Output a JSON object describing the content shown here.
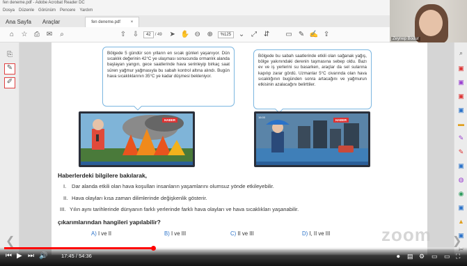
{
  "window": {
    "title": "fen deneme.pdf - Adobe Acrobat Reader DC"
  },
  "menu": [
    "Dosya",
    "Düzenle",
    "Görünüm",
    "Pencere",
    "Yardım"
  ],
  "tabs": {
    "home": "Ana Sayfa",
    "tools": "Araçlar",
    "doc": "fen deneme.pdf",
    "doc_close": "×"
  },
  "toolbar": {
    "page_current": "42",
    "page_total": "/ 49",
    "zoom": "%125"
  },
  "webcam": {
    "name": "Zeynep Bodur"
  },
  "page": {
    "bubble_left": "Bölgede 5 gündür son yılların en sıcak günleri yaşanıyor. Dün sıcaklık değerinin 42°C ye ulaşması sonucunda ormanlık alanda başlayan yangın, gece saatlerinde hava serinleyip birkaç saat süren yağmur yağmasıyla bu sabah kontrol altına alındı. Bugün hava sıcaklıklarının 35°C ye kadar düşmesi bekleniyor.",
    "bubble_right": "Bölgede bu sabah saatlerinde etkili olan sağanak yağış, bölge yakınındaki derenin taşmasına sebep oldu. Bazı ev ve iş yerlerini su basarken, araçlar da sel sularına kapılıp zarar gördü. Uzmanlar 5°C civarında olan hava sıcaklığının bugünden sonra artacağını ve yağmurun etkisinin azalacağını belirttiler.",
    "tv_badge": "HABER",
    "tv_time": "16:00",
    "question_title": "Haberlerdeki bilgilere bakılarak,",
    "statements": [
      {
        "roman": "I.",
        "text": "Dar alanda etkili olan hava koşulları insanların yaşamlarını olumsuz yönde etkileyebilir."
      },
      {
        "roman": "II.",
        "text": "Hava olayları kısa zaman dilimlerinde değişkenlik gösterir."
      },
      {
        "roman": "III.",
        "text": "Yılın aynı tarihlerinde dünyanın farklı yerlerinde farklı hava olayları ve hava sıcaklıkları yaşanabilir."
      }
    ],
    "question_ask": "çıkarımlarından hangileri yapılabilir?",
    "options": [
      {
        "letter": "A)",
        "text": "I ve II"
      },
      {
        "letter": "B)",
        "text": "I ve III"
      },
      {
        "letter": "C)",
        "text": "II ve III"
      },
      {
        "letter": "D)",
        "text": "I, II ve III"
      }
    ]
  },
  "watermark": "zoom",
  "player": {
    "current_time": "17:45",
    "separator": "/",
    "duration": "54:36",
    "progress_fraction": 0.325
  },
  "colors": {
    "accent": "#ff0000",
    "link_blue": "#2a72c9",
    "bubble_border": "#7bb6e0"
  }
}
